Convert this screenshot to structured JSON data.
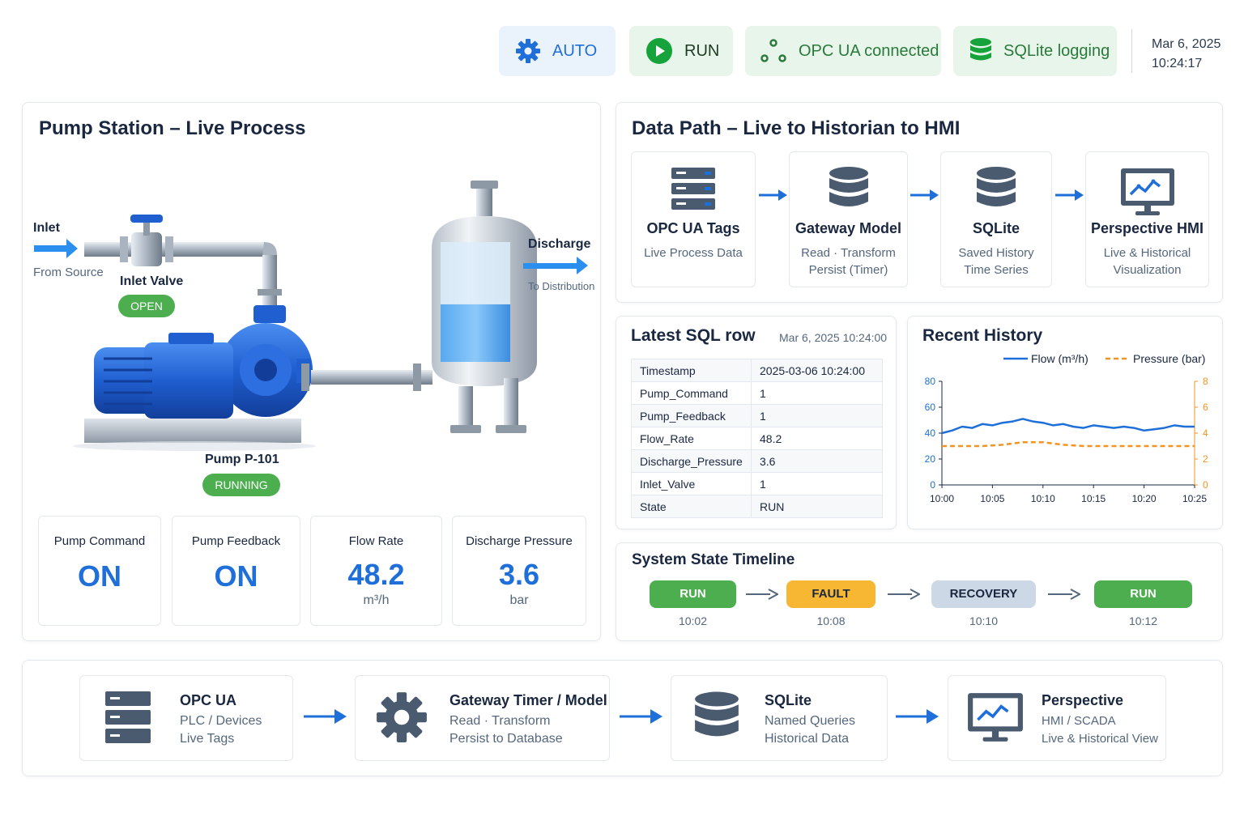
{
  "header": {
    "chips": {
      "auto": "AUTO",
      "run": "RUN",
      "opc": "OPC UA connected",
      "sqlite": "SQLite logging"
    },
    "date": "Mar 6, 2025",
    "time": "10:24:17"
  },
  "process": {
    "title": "Pump Station – Live Process",
    "inlet": "Inlet",
    "from_source": "From Source",
    "inlet_valve": "Inlet Valve",
    "valve_state": "OPEN",
    "discharge": "Discharge",
    "to_distribution": "To Distribution",
    "pump_name": "Pump P-101",
    "pump_state": "RUNNING",
    "tank_level": 0.48,
    "kpis": [
      {
        "title": "Pump Command",
        "value": "ON",
        "unit": ""
      },
      {
        "title": "Pump Feedback",
        "value": "ON",
        "unit": ""
      },
      {
        "title": "Flow Rate",
        "value": "48.2",
        "unit": "m³/h"
      },
      {
        "title": "Discharge Pressure",
        "value": "3.6",
        "unit": "bar"
      }
    ]
  },
  "datapath": {
    "title": "Data Path – Live to Historian to HMI",
    "cards": [
      {
        "title": "OPC UA Tags",
        "line1": "Live Process Data",
        "line2": ""
      },
      {
        "title": "Gateway Model",
        "line1": "Read · Transform",
        "line2": "Persist (Timer)"
      },
      {
        "title": "SQLite",
        "line1": "Saved History",
        "line2": "Time Series"
      },
      {
        "title": "Perspective HMI",
        "line1": "Live & Historical",
        "line2": "Visualization"
      }
    ]
  },
  "sql": {
    "title": "Latest SQL row",
    "timestamp": "Mar 6, 2025 10:24:00",
    "rows": [
      {
        "key": "Timestamp",
        "value": "2025-03-06 10:24:00"
      },
      {
        "key": "Pump_Command",
        "value": "1"
      },
      {
        "key": "Pump_Feedback",
        "value": "1"
      },
      {
        "key": "Flow_Rate",
        "value": "48.2"
      },
      {
        "key": "Discharge_Pressure",
        "value": "3.6"
      },
      {
        "key": "Inlet_Valve",
        "value": "1"
      },
      {
        "key": "State",
        "value": "RUN"
      }
    ]
  },
  "chart_data": {
    "type": "line",
    "title": "Recent History",
    "xlabel": "",
    "ylabel": "",
    "x_ticks": [
      "10:00",
      "10:05",
      "10:10",
      "10:15",
      "10:20",
      "10:25"
    ],
    "y_left_ticks": [
      "0",
      "20",
      "40",
      "60",
      "80"
    ],
    "y_right_ticks": [
      "0",
      "2",
      "4",
      "6",
      "8"
    ],
    "ylim_left": [
      0,
      80
    ],
    "ylim_right": [
      0,
      8
    ],
    "xlim": [
      0,
      25
    ],
    "legend_position": "top-right",
    "series": [
      {
        "name": "Flow (m³/h)",
        "axis": "left",
        "color": "#1e6fd9",
        "style": "solid",
        "x": [
          0,
          1,
          2,
          3,
          4,
          5,
          6,
          7,
          8,
          9,
          10,
          11,
          12,
          13,
          14,
          15,
          16,
          17,
          18,
          19,
          20,
          21,
          22,
          23,
          24,
          25
        ],
        "y": [
          40,
          42,
          45,
          44,
          47,
          46,
          48,
          49,
          51,
          49,
          48,
          46,
          47,
          45,
          44,
          46,
          45,
          44,
          45,
          44,
          42,
          43,
          44,
          46,
          45,
          45
        ]
      },
      {
        "name": "Pressure (bar)",
        "axis": "right",
        "color": "#f39321",
        "style": "dashed",
        "x": [
          0,
          2,
          4,
          6,
          8,
          10,
          12,
          14,
          16,
          18,
          20,
          22,
          24,
          25
        ],
        "y": [
          3.0,
          3.0,
          3.0,
          3.1,
          3.3,
          3.3,
          3.1,
          3.0,
          3.0,
          3.0,
          3.0,
          3.0,
          3.0,
          3.0
        ]
      }
    ]
  },
  "timeline": {
    "title": "System State Timeline",
    "states": [
      {
        "label": "RUN",
        "time": "10:02",
        "bg": "#4cae4f",
        "fg": "#ffffff"
      },
      {
        "label": "FAULT",
        "time": "10:08",
        "bg": "#f7b733",
        "fg": "#1a2740"
      },
      {
        "label": "RECOVERY",
        "time": "10:10",
        "bg": "#cdd8e6",
        "fg": "#1a2740"
      },
      {
        "label": "RUN",
        "time": "10:12",
        "bg": "#4cae4f",
        "fg": "#ffffff"
      }
    ]
  },
  "architecture": {
    "cards": [
      {
        "title": "OPC UA",
        "line1": "PLC / Devices",
        "line2": "Live Tags"
      },
      {
        "title": "Gateway Timer / Model",
        "line1": "Read · Transform",
        "line2": "Persist to Database"
      },
      {
        "title": "SQLite",
        "line1": "Named Queries",
        "line2": "Historical Data"
      },
      {
        "title": "Perspective",
        "line1": "HMI / SCADA",
        "line2": "Live & Historical View"
      }
    ]
  },
  "colors": {
    "accent": "#1e6fd9",
    "ok": "#4cae4f",
    "warning": "#f7b733",
    "pressure": "#f39321"
  }
}
